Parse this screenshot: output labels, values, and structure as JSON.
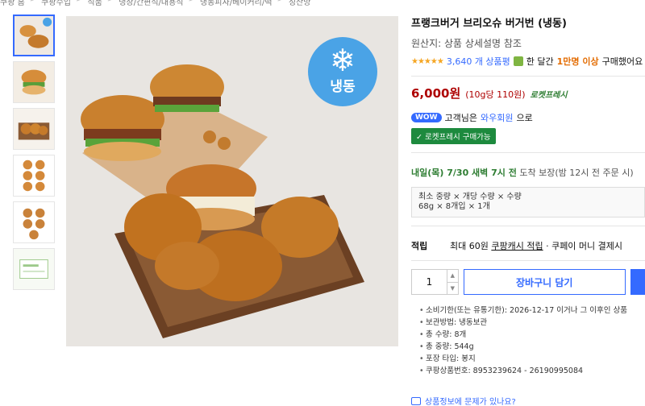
{
  "breadcrumb": [
    "쿠팡 홈",
    "쿠팡수입",
    "식품",
    "냉장/간편식/대용식",
    "냉동피자/베이커리/떡",
    "징산방"
  ],
  "product": {
    "title": "프랭크버거 브리오슈 버거번 (냉동)",
    "origin": "원산지: 상품 상세설명 참조",
    "rating_stars": "★★★★★",
    "review_count": "3,640 개 상품평",
    "purchase_text_a": "한 달간",
    "purchase_highlight": "1만명 이상",
    "purchase_text_b": "구매했어요",
    "price": "6,000원",
    "unit_price": "(10g당 110원)",
    "rocket_badge": "로켓프레시",
    "image_badge": "냉동",
    "image_snow": "❄"
  },
  "wow": {
    "badge": "WOW",
    "text_a": "고객님은",
    "link": "와우회원",
    "text_b": "으로",
    "rocket_button": "✓ 로켓프레시 구매가능"
  },
  "delivery": {
    "date": "내일(목) 7/30 새벽 7시 전",
    "guarantee": "도착 보장",
    "note": "(밤 12시 전 주문 시)"
  },
  "option": {
    "header": "최소 중량 × 개당 수량 × 수량",
    "value": "68g × 8개입 × 1개"
  },
  "reward": {
    "label": "적립",
    "text": "최대 60원",
    "link": "쿠팡캐시 적립",
    "suffix": "· 쿠페이 머니 결제시"
  },
  "purchase": {
    "quantity": "1",
    "step_up": "▲",
    "step_down": "▼",
    "cart_label": "장바구니 담기"
  },
  "specs": [
    "소비기한(또는 유통기한): 2026-12-17 이거나 그 이후인 상품",
    "보관방법: 냉동보관",
    "총 수량: 8개",
    "총 중량: 544g",
    "포장 타입: 봉지",
    "쿠팡상품번호: 8953239624 - 26190995084"
  ],
  "report_link": "상품정보에 문제가 있나요?",
  "colors": {
    "accent": "#346aff",
    "price": "#ae0000",
    "rocket_green": "#1d8a3e",
    "badge_blue": "#4aa3e6"
  }
}
